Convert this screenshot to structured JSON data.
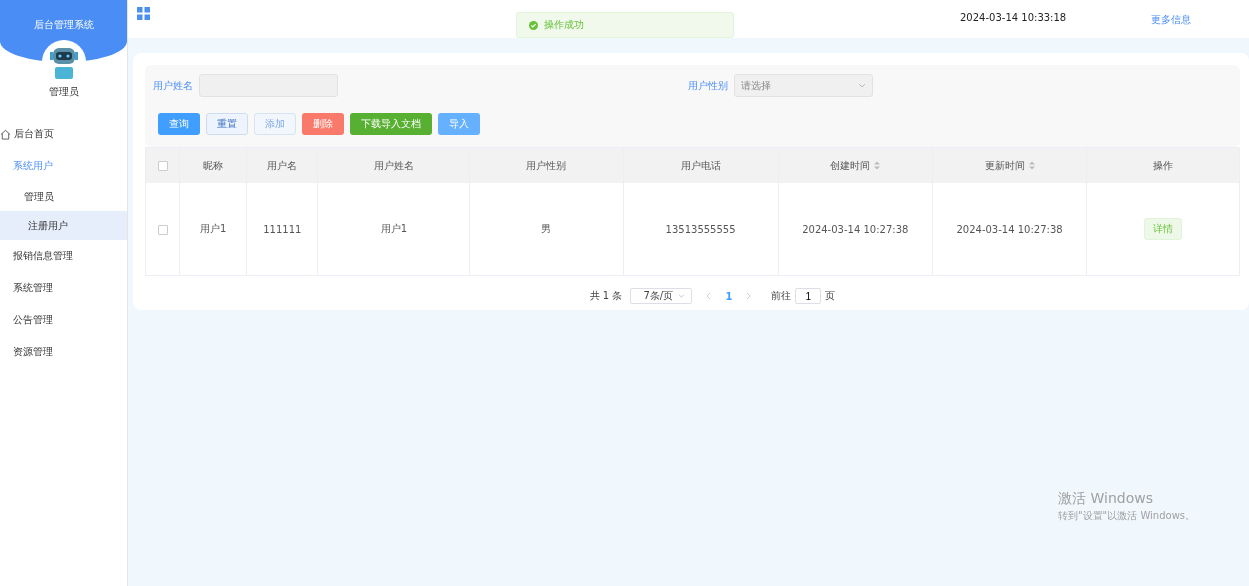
{
  "sidebar": {
    "title": "后台管理系统",
    "user": "管理员",
    "items": [
      {
        "label": "后台首页",
        "selected": false,
        "expanded": false
      },
      {
        "label": "系统用户",
        "selected": false,
        "expanded": true,
        "children": [
          {
            "label": "管理员",
            "selected": false
          },
          {
            "label": "注册用户",
            "selected": true
          }
        ]
      },
      {
        "label": "报销信息管理",
        "selected": false,
        "expanded": false
      },
      {
        "label": "系统管理",
        "selected": false,
        "expanded": false
      },
      {
        "label": "公告管理",
        "selected": false,
        "expanded": false
      },
      {
        "label": "资源管理",
        "selected": false,
        "expanded": false
      }
    ]
  },
  "header": {
    "datetime": "2024-03-14 10:33:18",
    "more_link": "更多信息"
  },
  "toast": {
    "message": "操作成功"
  },
  "search": {
    "name_label": "用户姓名",
    "gender_label": "用户性别",
    "gender_placeholder": "请选择"
  },
  "buttons": [
    {
      "label": "查询",
      "kind": "primary"
    },
    {
      "label": "重置",
      "kind": "plain"
    },
    {
      "label": "添加",
      "kind": "light"
    },
    {
      "label": "删除",
      "kind": "danger"
    },
    {
      "label": "下载导入文档",
      "kind": "success"
    },
    {
      "label": "导入",
      "kind": "info"
    }
  ],
  "table": {
    "all_checked": false,
    "columns": [
      {
        "label": "昵称",
        "sortable": false
      },
      {
        "label": "用户名",
        "sortable": false
      },
      {
        "label": "用户姓名",
        "sortable": false
      },
      {
        "label": "用户性别",
        "sortable": false
      },
      {
        "label": "用户电话",
        "sortable": false
      },
      {
        "label": "创建时间",
        "sortable": true
      },
      {
        "label": "更新时间",
        "sortable": true
      },
      {
        "label": "操作",
        "sortable": false
      }
    ],
    "rows": [
      {
        "checked": false,
        "cells": [
          "用户1",
          "111111",
          "用户1",
          "男",
          "13513555555",
          "2024-03-14 10:27:38",
          "2024-03-14 10:27:38"
        ],
        "action": "详情"
      }
    ]
  },
  "pagination": {
    "total": "共 1 条",
    "page_size": "7条/页",
    "pages": [
      {
        "label": "1",
        "selected": true
      }
    ],
    "goto_label": "前往",
    "goto_value": "1",
    "goto_suffix": "页"
  },
  "os_notice": {
    "title": "激活 Windows",
    "text": "转到\"设置\"以激活 Windows。"
  }
}
